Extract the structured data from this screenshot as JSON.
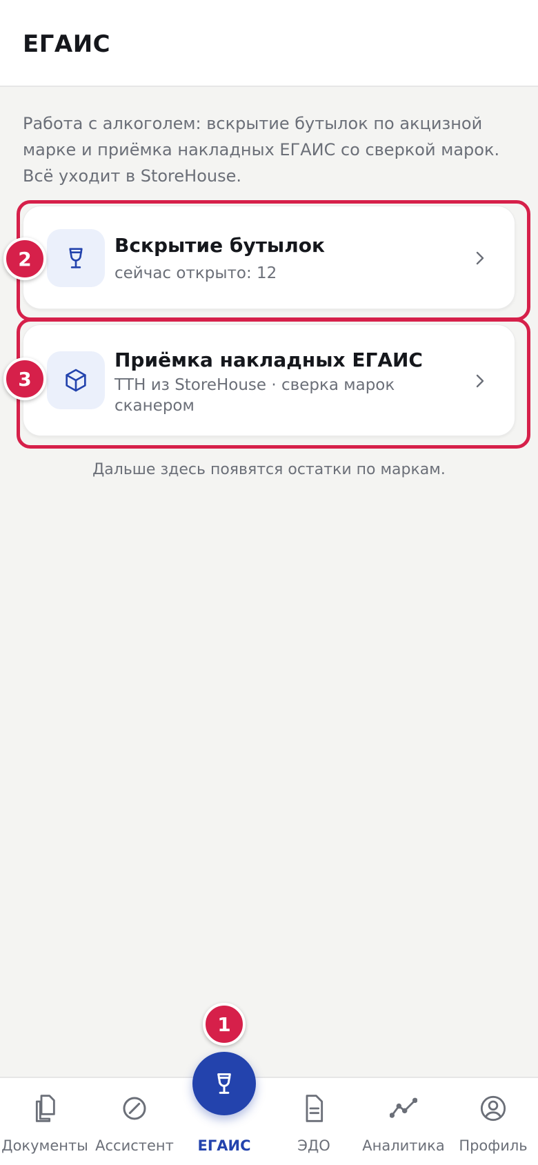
{
  "header": {
    "title": "ЕГАИС"
  },
  "intro": {
    "text": "Работа с алкоголем: вскрытие бутылок по акцизной марке и приёмка накладных ЕГАИС со сверкой марок. Всё уходит в StoreHouse."
  },
  "cards": [
    {
      "title": "Вскрытие бутылок",
      "subtitle": "сейчас открыто: 12",
      "icon": "wine-glass-icon"
    },
    {
      "title": "Приёмка накладных ЕГАИС",
      "subtitle": "ТТН из StoreHouse · сверка марок сканером",
      "icon": "box-icon"
    }
  ],
  "footnote": "Дальше здесь появятся остатки по маркам.",
  "badges": {
    "b1": "1",
    "b2": "2",
    "b3": "3"
  },
  "tabs": [
    {
      "label": "Документы",
      "icon": "documents-icon"
    },
    {
      "label": "Ассистент",
      "icon": "assistant-icon"
    },
    {
      "label": "ЕГАИС",
      "icon": "wine-glass-icon",
      "active": true
    },
    {
      "label": "ЭДО",
      "icon": "file-icon"
    },
    {
      "label": "Аналитика",
      "icon": "analytics-icon"
    },
    {
      "label": "Профиль",
      "icon": "profile-icon"
    }
  ],
  "colors": {
    "accent": "#2343ad",
    "highlight": "#d6204a",
    "background": "#f4f4f2"
  }
}
